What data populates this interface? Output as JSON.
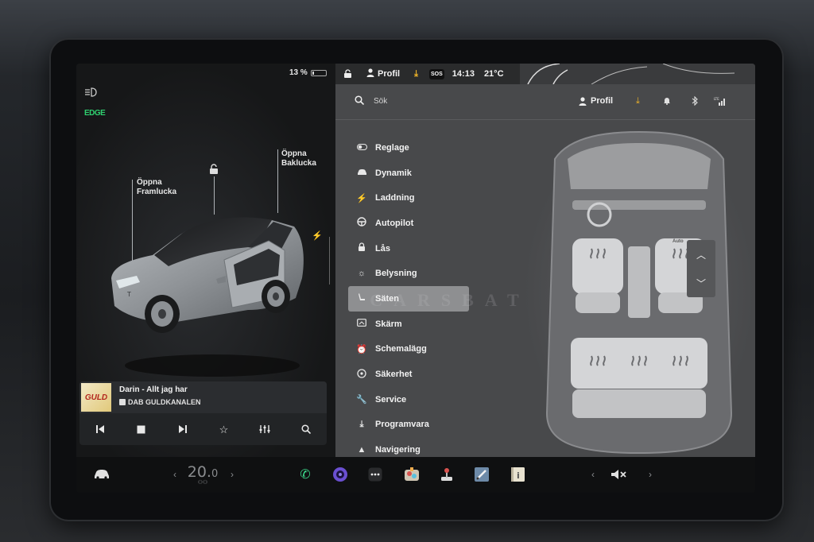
{
  "left_pane": {
    "battery": {
      "percent_label": "13 %",
      "level": 0.13
    },
    "callouts": {
      "frunk": {
        "line1": "Öppna",
        "line2": "Framlucka"
      },
      "trunk": {
        "line1": "Öppna",
        "line2": "Baklucka"
      }
    },
    "icons": {
      "lights": "headlight-icon",
      "edge": "EDGE"
    }
  },
  "music": {
    "album_art_text": "GULD",
    "song": "Darin - Allt jag har",
    "station": "DAB GULDKANALEN",
    "controls": [
      "skip-previous-icon",
      "stop-icon",
      "skip-next-icon",
      "star-icon",
      "equalizer-icon",
      "search-icon"
    ]
  },
  "status_bar": {
    "profile": "Profil",
    "sos": "SOS",
    "time": "14:13",
    "temperature": "21°C"
  },
  "settings": {
    "search_label": "Sök",
    "header_profile": "Profil",
    "menu": [
      {
        "label": "Reglage",
        "icon": "toggle-icon"
      },
      {
        "label": "Dynamik",
        "icon": "car-icon"
      },
      {
        "label": "Laddning",
        "icon": "lightning-icon"
      },
      {
        "label": "Autopilot",
        "icon": "steering-wheel-icon"
      },
      {
        "label": "Lås",
        "icon": "lock-icon"
      },
      {
        "label": "Belysning",
        "icon": "light-icon"
      },
      {
        "label": "Säten",
        "icon": "seat-icon",
        "active": true
      },
      {
        "label": "Skärm",
        "icon": "screen-icon"
      },
      {
        "label": "Schemalägg",
        "icon": "alarm-icon"
      },
      {
        "label": "Säkerhet",
        "icon": "safety-icon"
      },
      {
        "label": "Service",
        "icon": "wrench-icon"
      },
      {
        "label": "Programvara",
        "icon": "download-icon"
      },
      {
        "label": "Navigering",
        "icon": "navigation-icon"
      }
    ],
    "seat_heat_labels": {
      "auto": "Auto"
    }
  },
  "dock": {
    "temperature": "20.0",
    "temperature_main": "20.",
    "temperature_decimal": "0"
  },
  "watermark": "CARSBAT",
  "colors": {
    "edge_green": "#2fd06f",
    "download_accent": "#f0b429",
    "active_menu_bg": "#8e8f91"
  }
}
